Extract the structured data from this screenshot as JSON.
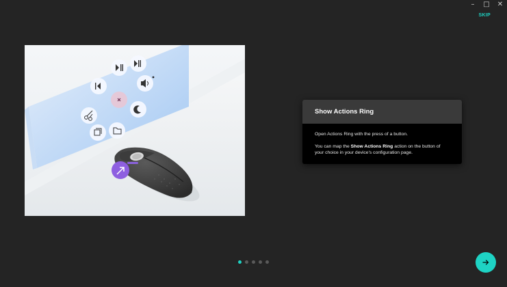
{
  "window": {
    "minimize": "–",
    "restore": "□",
    "close": "✕"
  },
  "skip_label": "SKIP",
  "card": {
    "title": "Show Actions Ring",
    "line1": "Open Actions Ring with the press of a button.",
    "line2_prefix": "You can map the ",
    "line2_bold": "Show Actions Ring",
    "line2_suffix": " action on the button of your choice in your device's configuration page."
  },
  "pagination": {
    "total": 5,
    "active": 0
  },
  "colors": {
    "accent": "#1ed3c4",
    "background": "#242424",
    "card": "#000000",
    "card_header": "#3a3a3a",
    "ring_button": "#8e5fe0"
  },
  "icons": {
    "next": "arrow-right-icon",
    "ring_actions": [
      "previous-track-icon",
      "play-pause-icon",
      "next-track-icon",
      "volume-icon",
      "screenshot-icon",
      "do-not-disturb-icon",
      "folder-icon",
      "snipping-icon",
      "copy-icon"
    ]
  }
}
